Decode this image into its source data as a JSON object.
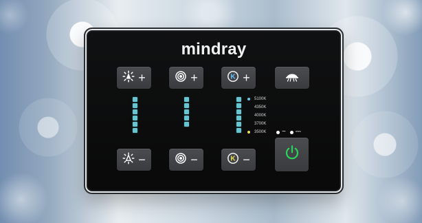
{
  "brand": {
    "name": "mindray"
  },
  "buttons": {
    "brightness_plus": {
      "sign": "+",
      "icon": "sun-icon"
    },
    "focus_plus": {
      "sign": "+",
      "icon": "focus-icon"
    },
    "temperature_plus": {
      "sign": "+",
      "icon": "k-icon",
      "label": "K"
    },
    "lamp_mode": {
      "icon": "lamp-icon"
    },
    "brightness_minus": {
      "sign": "−",
      "icon": "sun-outline-icon"
    },
    "focus_minus": {
      "sign": "−",
      "icon": "focus-icon"
    },
    "temperature_minus": {
      "sign": "−",
      "icon": "k-icon",
      "label": "K"
    },
    "power": {
      "icon": "power-icon"
    }
  },
  "levels": {
    "brightness": {
      "segments": 6,
      "lit": 6
    },
    "focus": {
      "segments": 5,
      "lit": 5
    },
    "temperature": {
      "segments": 6,
      "lit": 6
    }
  },
  "color_temperatures": [
    {
      "label": "5100K",
      "state": "active"
    },
    {
      "label": "4350K",
      "state": ""
    },
    {
      "label": "4000K",
      "state": ""
    },
    {
      "label": "3700K",
      "state": ""
    },
    {
      "label": "3500K",
      "state": "selected"
    }
  ],
  "mode_indicator": {
    "ac_symbol": "~",
    "dc_symbol": "⎓"
  },
  "colors": {
    "meter": "#66c5d1",
    "temperature_active_dot": "#67c8e4",
    "temperature_selected_dot": "#e6e35d",
    "power_green": "#2bd45a",
    "k_plus": "#63bef6",
    "k_minus": "#e5de52"
  }
}
